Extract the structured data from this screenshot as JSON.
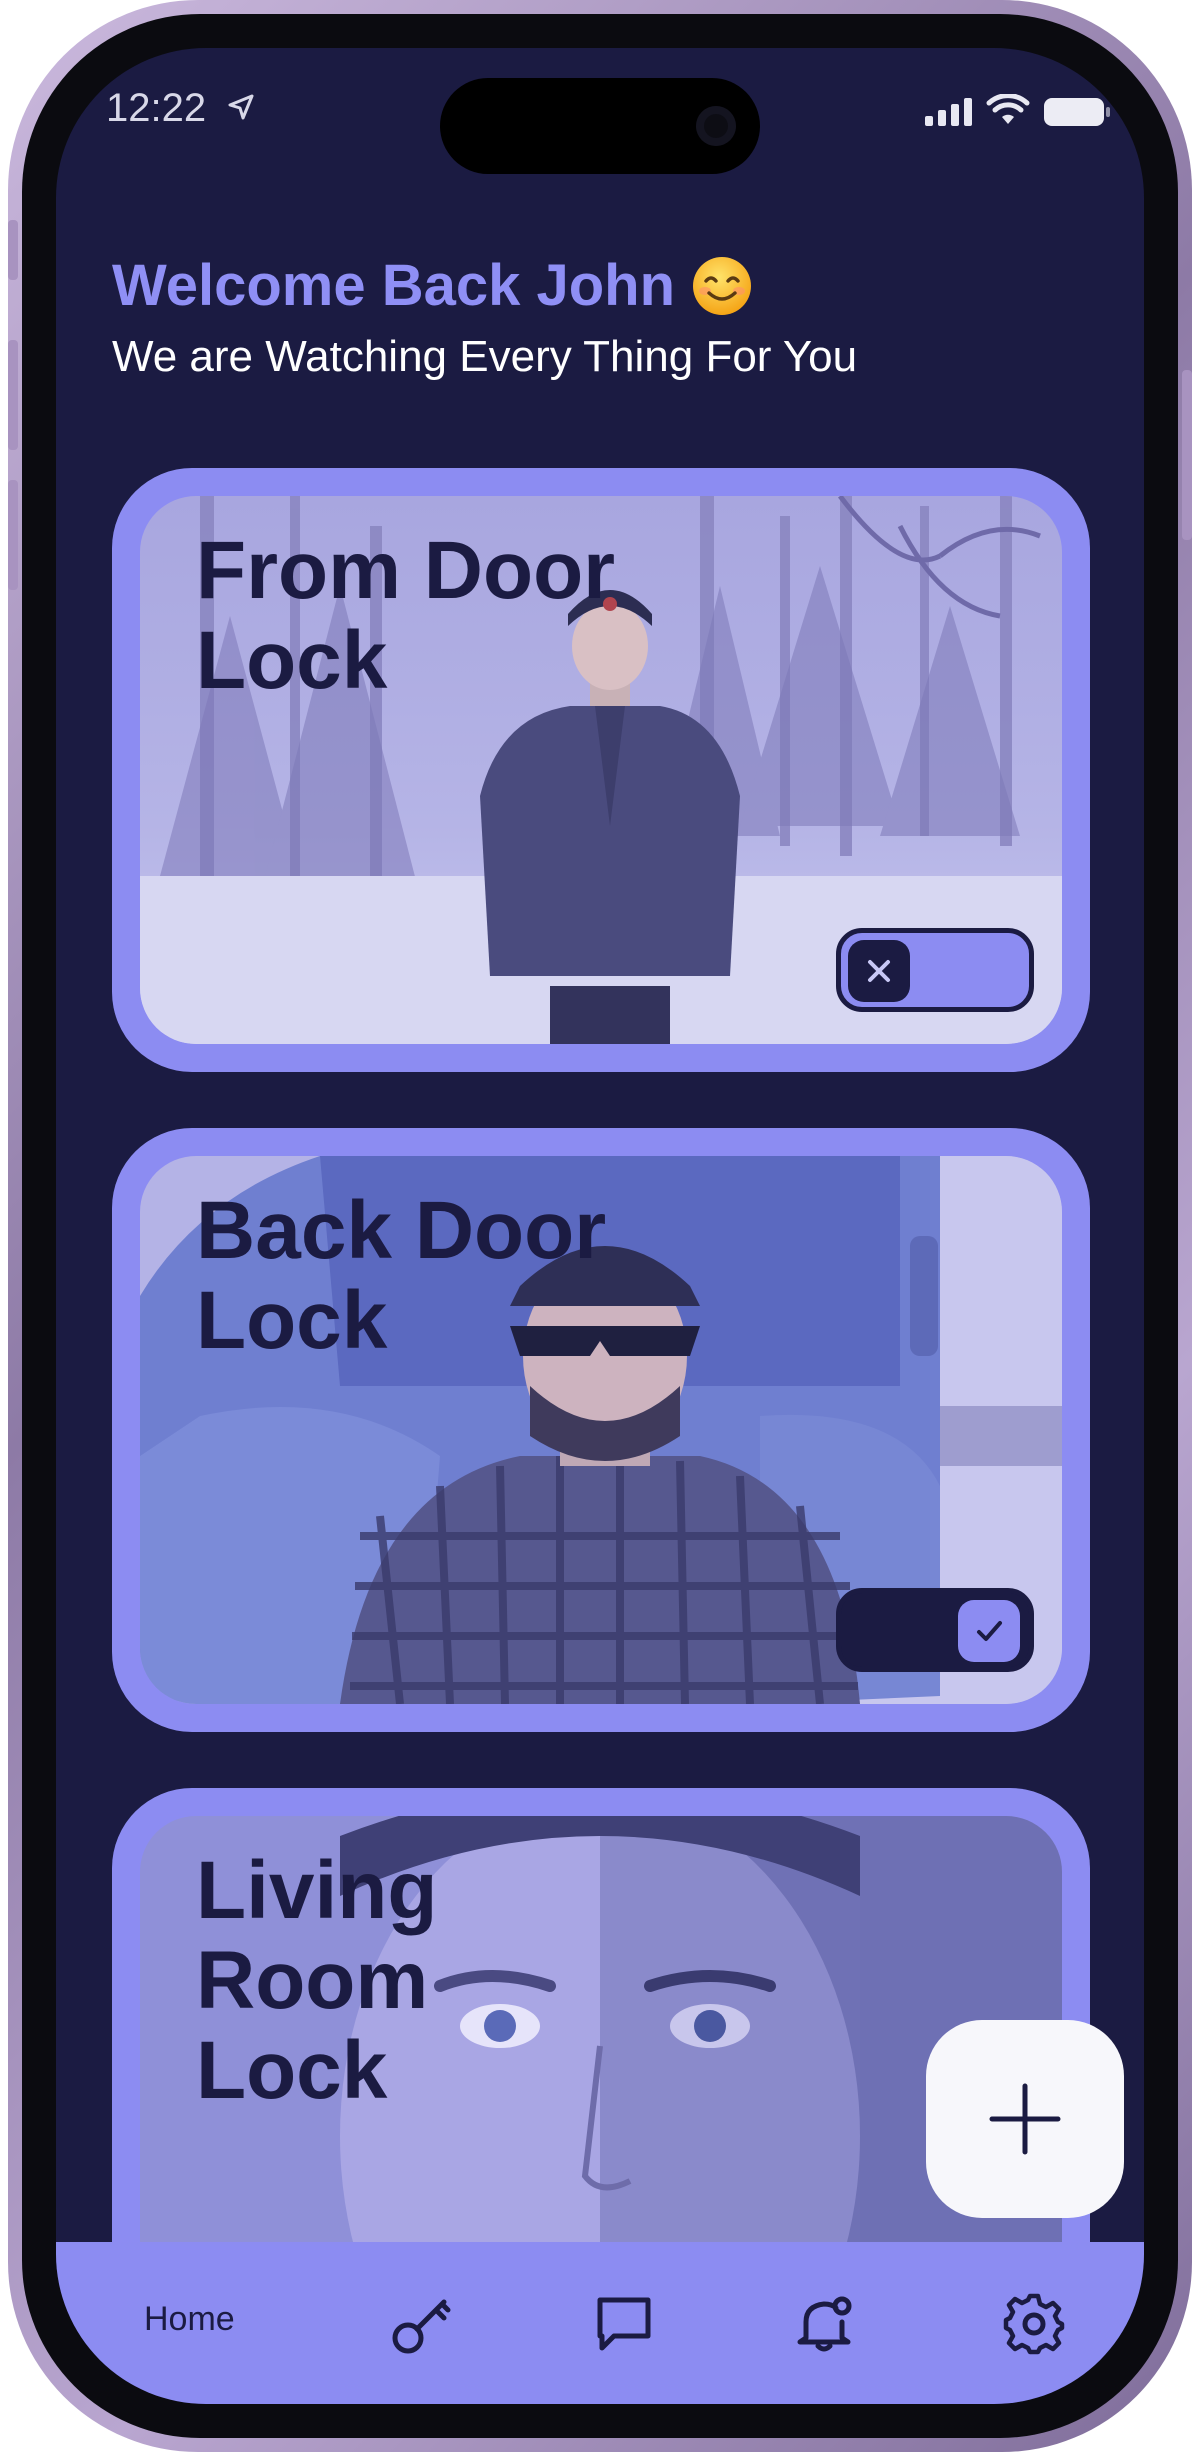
{
  "status_bar": {
    "time": "12:22"
  },
  "header": {
    "welcome": "Welcome Back John",
    "subtitle": "We are Watching Every Thing For You"
  },
  "locks": [
    {
      "title": "From Door\nLock",
      "locked": false
    },
    {
      "title": "Back Door\nLock",
      "locked": true
    },
    {
      "title": "Living\nRoom\nLock"
    }
  ],
  "bottom_nav": {
    "items": [
      {
        "label": "Home",
        "icon": "home"
      },
      {
        "icon": "key-icon"
      },
      {
        "icon": "chat-icon"
      },
      {
        "icon": "bell-icon"
      },
      {
        "icon": "gear-icon"
      }
    ]
  },
  "colors": {
    "background": "#1b1b42",
    "accent": "#8c8cf2",
    "fab": "#f7f7fb"
  }
}
